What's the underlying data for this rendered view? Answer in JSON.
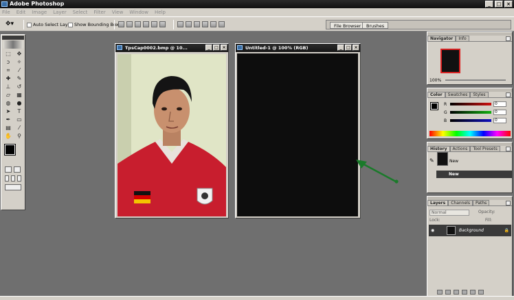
{
  "app": {
    "title": "Adobe Photoshop"
  },
  "menu": [
    "File",
    "Edit",
    "Image",
    "Layer",
    "Select",
    "Filter",
    "View",
    "Window",
    "Help"
  ],
  "options": {
    "auto_select_label": "Auto Select Layer",
    "bounding_box_label": "Show Bounding Box"
  },
  "palette_well": {
    "tabs": [
      "File Browser",
      "Brushes"
    ]
  },
  "documents": [
    {
      "title": "TpsCap0002.bmp @ 10..."
    },
    {
      "title": "Untitled-1 @ 100% (RGB)"
    }
  ],
  "navigator": {
    "tabs": [
      "Navigator",
      "Info"
    ],
    "zoom": "100%"
  },
  "color": {
    "tabs": [
      "Color",
      "Swatches",
      "Styles"
    ],
    "channels": [
      {
        "label": "R",
        "value": "0",
        "color": "#d01010"
      },
      {
        "label": "G",
        "value": "0",
        "color": "#10b010"
      },
      {
        "label": "B",
        "value": "0",
        "color": "#1010c0"
      }
    ]
  },
  "history": {
    "tabs": [
      "History",
      "Actions",
      "Tool Presets"
    ],
    "items": [
      "New",
      "New"
    ]
  },
  "layers": {
    "tabs": [
      "Layers",
      "Channels",
      "Paths"
    ],
    "blend_mode": "Normal",
    "opacity_label": "Opacity:",
    "lock_label": "Lock:",
    "fill_label": "Fill:",
    "layer_name": "Background"
  },
  "annotation": {
    "arrow_color": "#1a7a2a"
  }
}
